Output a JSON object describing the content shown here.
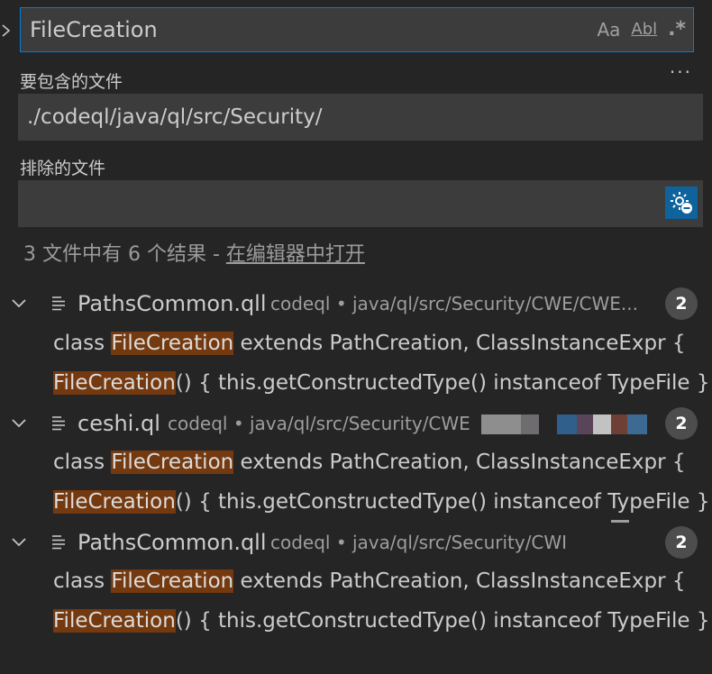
{
  "search": {
    "query": "FileCreation",
    "match_case": "Aa",
    "whole_word": "Abl",
    "regex": ".*"
  },
  "more": "...",
  "include": {
    "label": "要包含的文件",
    "value": "./codeql/java/ql/src/Security/"
  },
  "exclude": {
    "label": "排除的文件",
    "value": ""
  },
  "summary": {
    "text": "3 文件中有 6 个结果 - ",
    "link": "在编辑器中打开"
  },
  "results": [
    {
      "file": "PathsCommon.qll",
      "path": "codeql • java/ql/src/Security/CWE/CWE...",
      "count": "2",
      "matches": [
        {
          "pre": "class ",
          "hl": "FileCreation",
          "post": " extends PathCreation, ClassInstanceExpr {"
        },
        {
          "pre": "",
          "hl": "FileCreation",
          "post": "() { this.getConstructedType() instanceof TypeFile }"
        }
      ]
    },
    {
      "file": "ceshi.ql",
      "path": "codeql • java/ql/src/Security/CWE",
      "count": "2",
      "matches": [
        {
          "pre": "class ",
          "hl": "FileCreation",
          "post": " extends PathCreation, ClassInstanceExpr {"
        },
        {
          "pre": "",
          "hl": "FileCreation",
          "post": "() { this.getConstructedType() instanceof TypeFile }"
        }
      ]
    },
    {
      "file": "PathsCommon.qll",
      "path": "codeql • java/ql/src/Security/CWI",
      "count": "2",
      "matches": [
        {
          "pre": "class ",
          "hl": "FileCreation",
          "post": " extends PathCreation, ClassInstanceExpr {"
        },
        {
          "pre": "",
          "hl": "FileCreation",
          "post": "() { this.getConstructedType() instanceof TypeFile }"
        }
      ]
    }
  ],
  "colors": {
    "highlight": "#74390f",
    "focus_border": "#007fd4",
    "badge": "#4d4d4d",
    "button": "#0e639c"
  }
}
